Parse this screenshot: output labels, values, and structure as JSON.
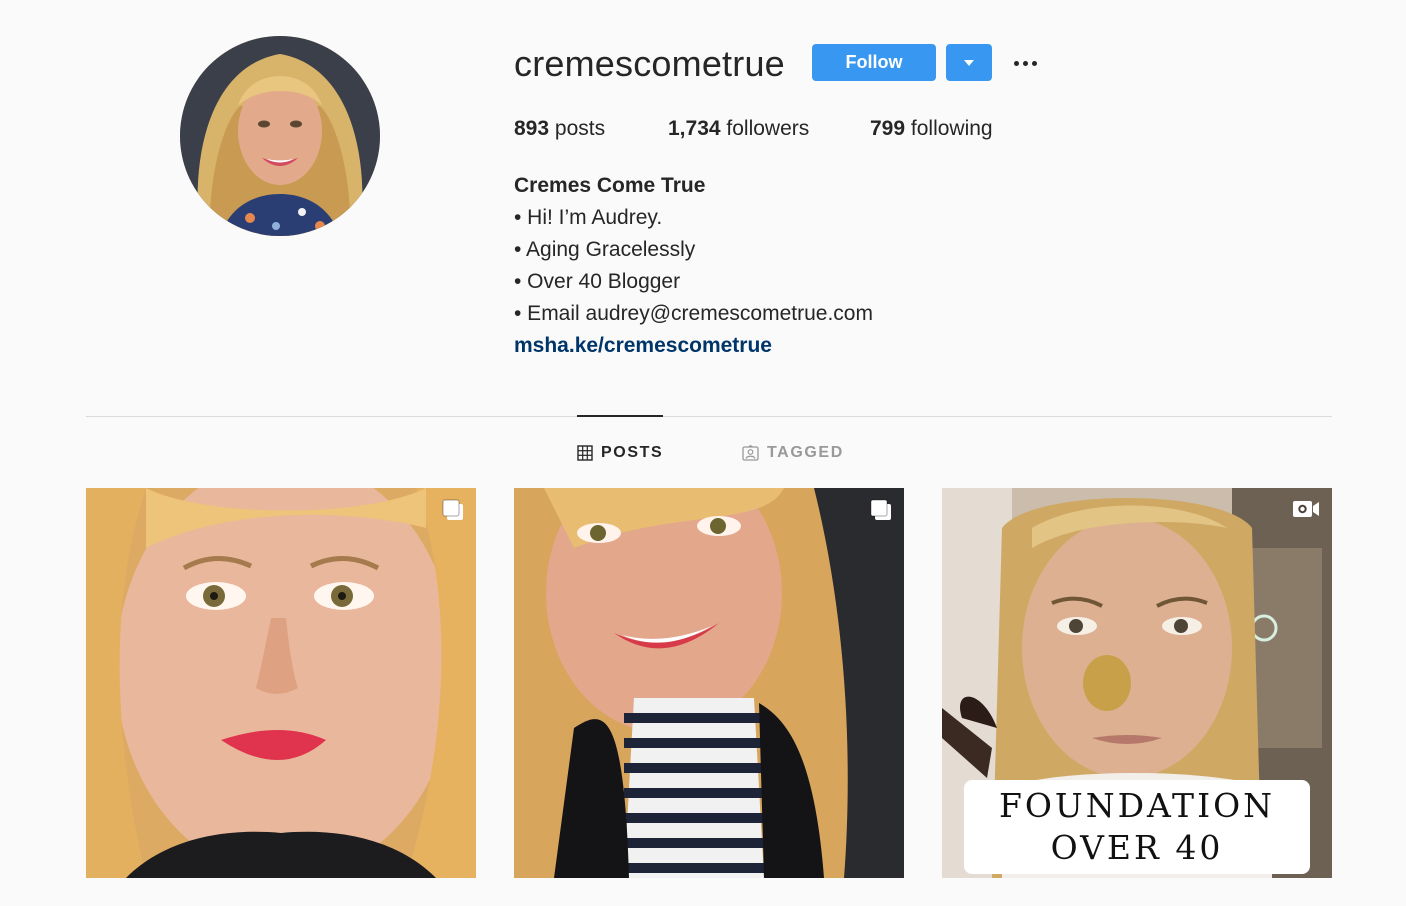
{
  "profile": {
    "username": "cremescometrue",
    "follow_label": "Follow",
    "stats": {
      "posts_count": "893",
      "posts_label": "posts",
      "followers_count": "1,734",
      "followers_label": "followers",
      "following_count": "799",
      "following_label": "following"
    },
    "bio": {
      "name": "Cremes Come True",
      "lines": [
        "• Hi! I’m Audrey.",
        "• Aging Gracelessly",
        "• Over 40 Blogger",
        "• Email audrey@cremescometrue.com"
      ],
      "link": "msha.ke/cremescometrue"
    }
  },
  "tabs": [
    {
      "label": "POSTS",
      "icon": "grid-icon",
      "active": true
    },
    {
      "label": "TAGGED",
      "icon": "tagged-icon",
      "active": false
    }
  ],
  "posts": [
    {
      "type": "carousel",
      "badge_icon": "carousel-icon"
    },
    {
      "type": "carousel",
      "badge_icon": "carousel-icon"
    },
    {
      "type": "video",
      "badge_icon": "video-icon",
      "caption": [
        "FOUNDATION",
        "OVER 40"
      ]
    }
  ],
  "colors": {
    "background": "#fafafa",
    "primary_button": "#3897f0",
    "link": "#003569",
    "divider": "#dbdbdb",
    "inactive_tab": "#999999"
  }
}
